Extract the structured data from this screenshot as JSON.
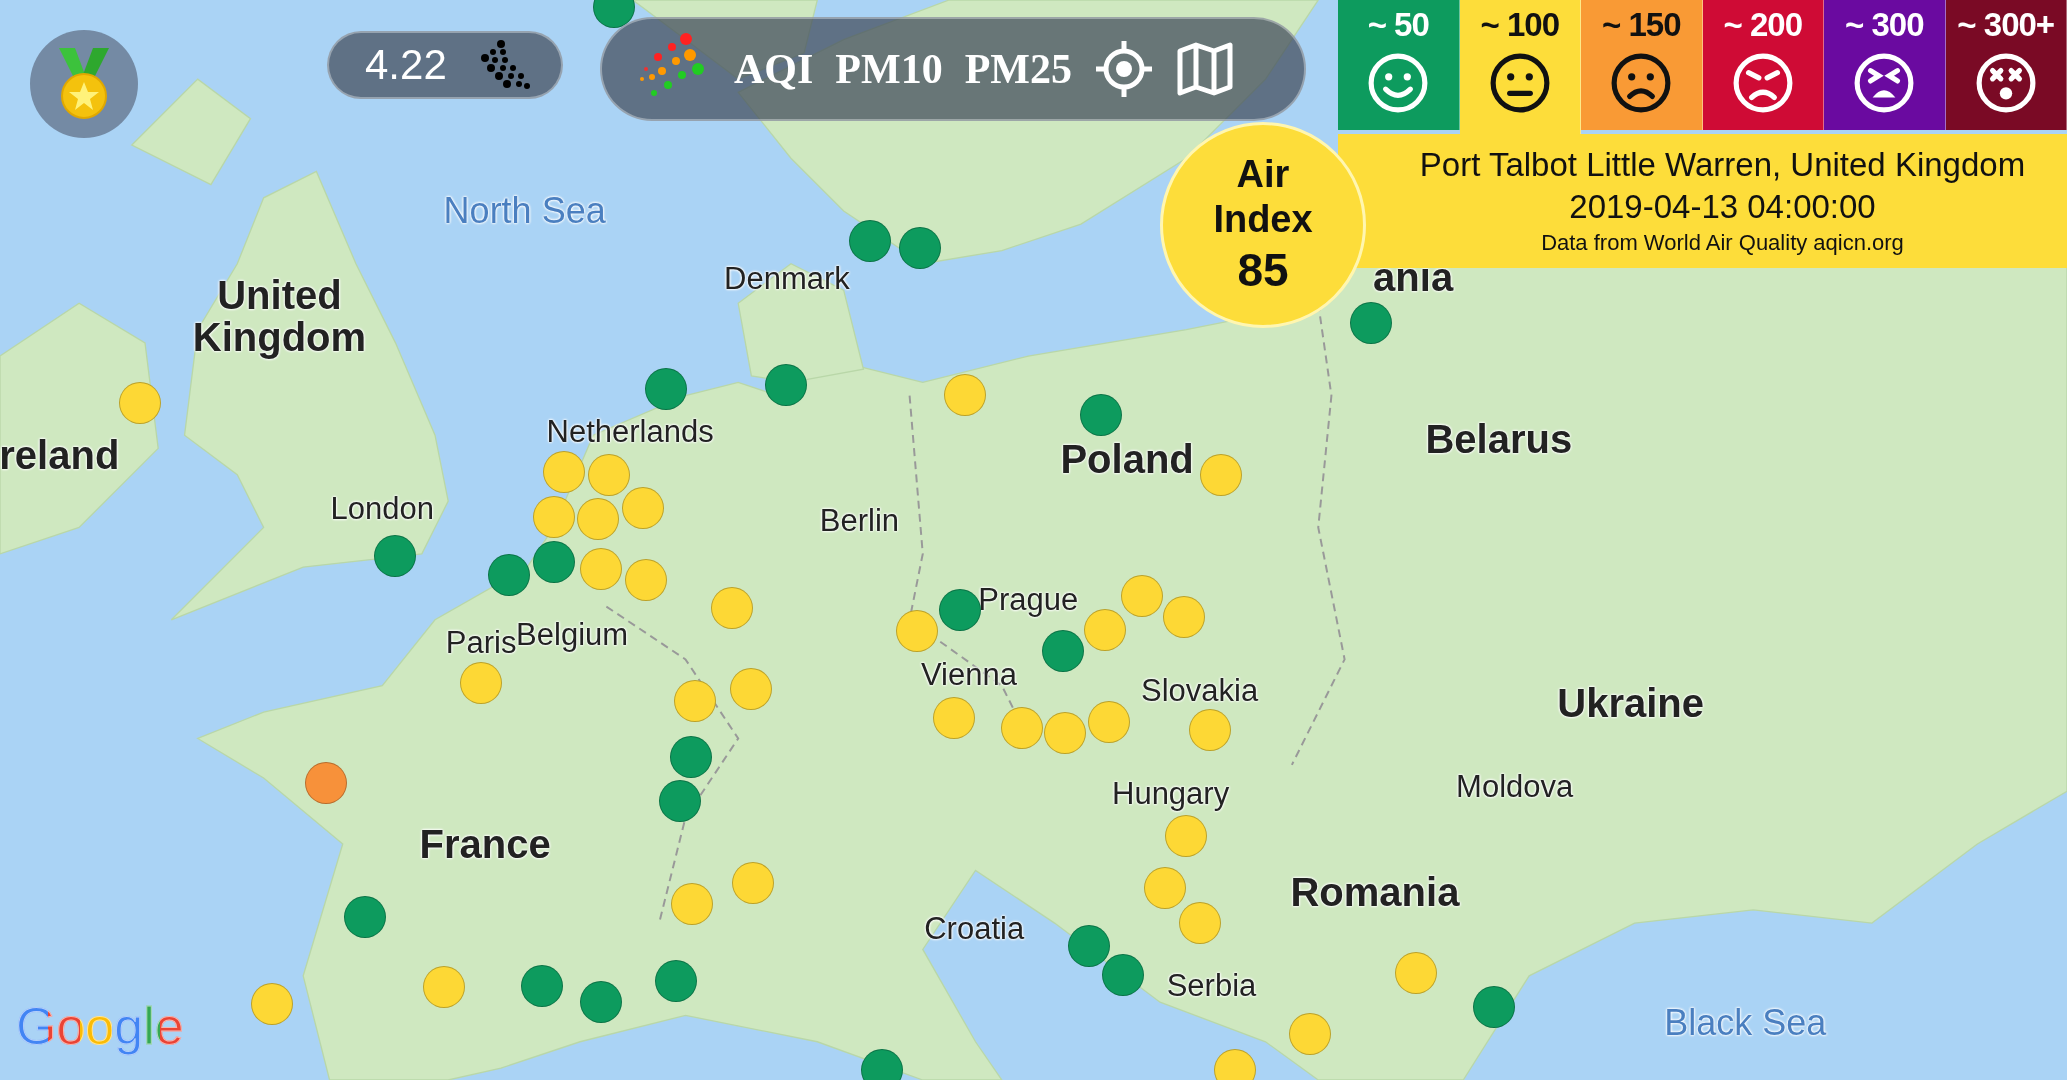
{
  "toolbar": {
    "aqi_value": "4.22",
    "buttons": [
      {
        "label": "AQI"
      },
      {
        "label": "PM10"
      },
      {
        "label": "PM25"
      }
    ]
  },
  "legend": [
    {
      "label": "~ 50",
      "color": "#0d9b5e",
      "kind": "smile",
      "selected": false
    },
    {
      "label": "~ 100",
      "color": "#fddd3a",
      "kind": "neutral",
      "selected": true
    },
    {
      "label": "~ 150",
      "color": "#f99a35",
      "kind": "frown",
      "selected": false
    },
    {
      "label": "~ 200",
      "color": "#cf0b35",
      "kind": "angry",
      "selected": false
    },
    {
      "label": "~ 300",
      "color": "#6a0aa0",
      "kind": "tired",
      "selected": false
    },
    {
      "label": "~ 300+",
      "color": "#7a0a25",
      "kind": "dizzy",
      "selected": false
    }
  ],
  "station": {
    "name": "Port Talbot Little Warren, United Kingdom",
    "time": "2019-04-13 04:00:00",
    "source": "Data from World Air Quality aqicn.org"
  },
  "air_index": {
    "line_1": "Air",
    "line_2": "Index",
    "value": "85"
  },
  "map_labels": [
    {
      "text": "North Sea",
      "kind": "sea"
    },
    {
      "text": "United Kingdom",
      "kind": "country"
    },
    {
      "text": "Denmark",
      "kind": "city"
    },
    {
      "text": "reland",
      "kind": "country"
    },
    {
      "text": "London",
      "kind": "city"
    },
    {
      "text": "Netherlands",
      "kind": "city"
    },
    {
      "text": "Berlin",
      "kind": "city"
    },
    {
      "text": "Poland",
      "kind": "country"
    },
    {
      "text": "Belarus",
      "kind": "country"
    },
    {
      "text": "ania",
      "kind": "country"
    },
    {
      "text": "Prague",
      "kind": "city"
    },
    {
      "text": "Belgium",
      "kind": "city"
    },
    {
      "text": "Paris",
      "kind": "city"
    },
    {
      "text": "Vienna",
      "kind": "city"
    },
    {
      "text": "Slovakia",
      "kind": "city"
    },
    {
      "text": "Ukraine",
      "kind": "country"
    },
    {
      "text": "Moldova",
      "kind": "city"
    },
    {
      "text": "Hungary",
      "kind": "city"
    },
    {
      "text": "France",
      "kind": "country"
    },
    {
      "text": "Romania",
      "kind": "country"
    },
    {
      "text": "Croatia",
      "kind": "city"
    },
    {
      "text": "Serbia",
      "kind": "city"
    },
    {
      "text": "Black Sea",
      "kind": "sea"
    }
  ],
  "stations": [
    {
      "color": "#0d9b5e"
    },
    {
      "color": "#0d9b5e"
    },
    {
      "color": "#0d9b5e"
    },
    {
      "color": "#0d9b5e"
    },
    {
      "color": "#0d9b5e"
    },
    {
      "color": "#0d9b5e"
    },
    {
      "color": "#0d9b5e"
    },
    {
      "color": "#0d9b5e"
    },
    {
      "color": "#0d9b5e"
    },
    {
      "color": "#0d9b5e"
    },
    {
      "color": "#0d9b5e"
    },
    {
      "color": "#0d9b5e"
    },
    {
      "color": "#0d9b5e"
    },
    {
      "color": "#0d9b5e"
    },
    {
      "color": "#0d9b5e"
    },
    {
      "color": "#0d9b5e"
    },
    {
      "color": "#0d9b5e"
    },
    {
      "color": "#0d9b5e"
    },
    {
      "color": "#0d9b5e"
    },
    {
      "color": "#0d9b5e"
    },
    {
      "color": "#0d9b5e"
    },
    {
      "color": "#0d9b5e"
    },
    {
      "color": "#fdd835"
    },
    {
      "color": "#fdd835"
    },
    {
      "color": "#fdd835"
    },
    {
      "color": "#fdd835"
    },
    {
      "color": "#fdd835"
    },
    {
      "color": "#fdd835"
    },
    {
      "color": "#fdd835"
    },
    {
      "color": "#fdd835"
    },
    {
      "color": "#fdd835"
    },
    {
      "color": "#fdd835"
    },
    {
      "color": "#fdd835"
    },
    {
      "color": "#fdd835"
    },
    {
      "color": "#fdd835"
    },
    {
      "color": "#fdd835"
    },
    {
      "color": "#fdd835"
    },
    {
      "color": "#fdd835"
    },
    {
      "color": "#fdd835"
    },
    {
      "color": "#fdd835"
    },
    {
      "color": "#fdd835"
    },
    {
      "color": "#fdd835"
    },
    {
      "color": "#fdd835"
    },
    {
      "color": "#fdd835"
    },
    {
      "color": "#fdd835"
    },
    {
      "color": "#fdd835"
    },
    {
      "color": "#fdd835"
    },
    {
      "color": "#fdd835"
    },
    {
      "color": "#fdd835"
    },
    {
      "color": "#fdd835"
    },
    {
      "color": "#fdd835"
    },
    {
      "color": "#fdd835"
    },
    {
      "color": "#fdd835"
    },
    {
      "color": "#fdd835"
    },
    {
      "color": "#fdd835"
    },
    {
      "color": "#f7913a"
    }
  ],
  "map_credit": "Google"
}
